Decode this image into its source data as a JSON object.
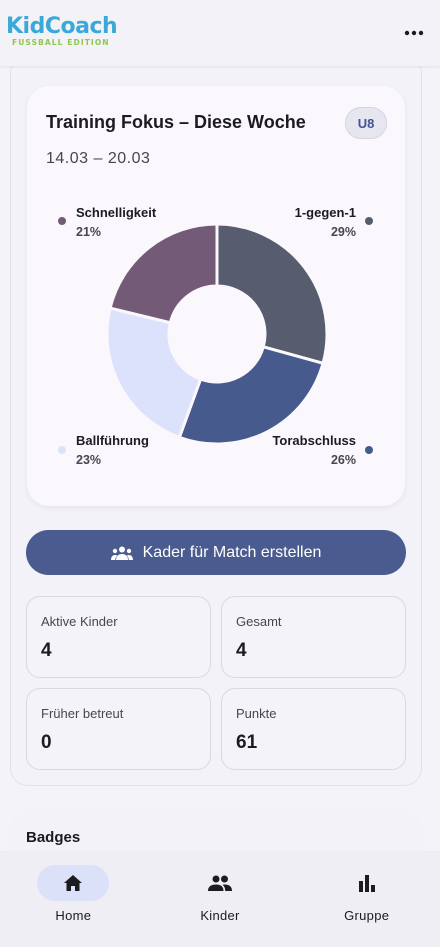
{
  "app": {
    "name": "KidCoach",
    "edition": "FUSSBALL EDITION"
  },
  "focus": {
    "title": "Training Fokus – Diese Woche",
    "date_range": "14.03 – 20.03",
    "age_group": "U8"
  },
  "chart_data": {
    "type": "pie",
    "variant": "donut",
    "title": "Training Fokus – Diese Woche",
    "slices": [
      {
        "label": "1-gegen-1",
        "value": 29,
        "pct_label": "29%",
        "color": "#575c6f"
      },
      {
        "label": "Torabschluss",
        "value": 26,
        "pct_label": "26%",
        "color": "#465a8e"
      },
      {
        "label": "Ballführung",
        "value": 23,
        "pct_label": "23%",
        "color": "#dce2fb"
      },
      {
        "label": "Schnelligkeit",
        "value": 21,
        "pct_label": "21%",
        "color": "#735a76"
      }
    ]
  },
  "actions": {
    "squad_label": "Kader für Match erstellen"
  },
  "stats": [
    {
      "label": "Aktive Kinder",
      "value": "4"
    },
    {
      "label": "Gesamt",
      "value": "4"
    },
    {
      "label": "Früher betreut",
      "value": "0"
    },
    {
      "label": "Punkte",
      "value": "61"
    }
  ],
  "badges": {
    "title": "Badges"
  },
  "nav": [
    {
      "label": "Home",
      "icon": "home-icon",
      "active": true
    },
    {
      "label": "Kinder",
      "icon": "people-icon",
      "active": false
    },
    {
      "label": "Gruppe",
      "icon": "bar-chart-icon",
      "active": false
    }
  ],
  "colors": {
    "primary": "#4a5b8f",
    "accent_logo": "#3aa9d9",
    "accent_edition": "#8fc64d",
    "nav_active": "#dbe1f9"
  }
}
